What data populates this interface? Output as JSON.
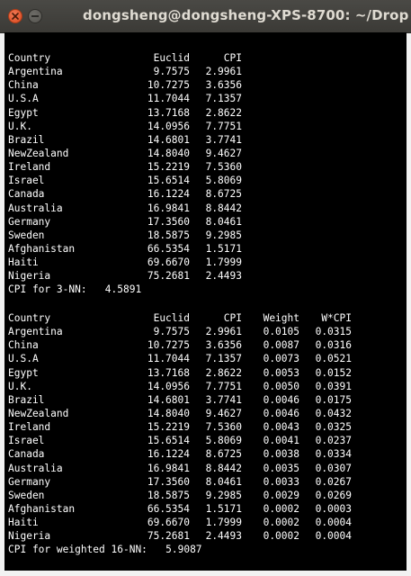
{
  "window": {
    "title": "dongsheng@dongsheng-XPS-8700: ~/Drop",
    "buttons": {
      "close": "close-icon",
      "minimize": "minimize-icon"
    },
    "colors": {
      "titlebar": "#3c3b37",
      "close": "#e0522a",
      "terminal_bg": "#000000",
      "text": "#ffffff"
    }
  },
  "table1": {
    "headers": [
      "Country",
      "Euclid",
      "CPI"
    ],
    "rows": [
      [
        "Argentina",
        "9.7575",
        "2.9961"
      ],
      [
        "China",
        "10.7275",
        "3.6356"
      ],
      [
        "U.S.A",
        "11.7044",
        "7.1357"
      ],
      [
        "Egypt",
        "13.7168",
        "2.8622"
      ],
      [
        "U.K.",
        "14.0956",
        "7.7751"
      ],
      [
        "Brazil",
        "14.6801",
        "3.7741"
      ],
      [
        "NewZealand",
        "14.8040",
        "9.4627"
      ],
      [
        "Ireland",
        "15.2219",
        "7.5360"
      ],
      [
        "Israel",
        "15.6514",
        "5.8069"
      ],
      [
        "Canada",
        "16.1224",
        "8.6725"
      ],
      [
        "Australia",
        "16.9841",
        "8.8442"
      ],
      [
        "Germany",
        "17.3560",
        "8.0461"
      ],
      [
        "Sweden",
        "18.5875",
        "9.2985"
      ],
      [
        "Afghanistan",
        "66.5354",
        "1.5171"
      ],
      [
        "Haiti",
        "69.6670",
        "1.7999"
      ],
      [
        "Nigeria",
        "75.2681",
        "2.4493"
      ]
    ],
    "result": "CPI for 3-NN:   4.5891"
  },
  "table2": {
    "headers": [
      "Country",
      "Euclid",
      "CPI",
      "Weight",
      "W*CPI"
    ],
    "rows": [
      [
        "Argentina",
        "9.7575",
        "2.9961",
        "0.0105",
        "0.0315"
      ],
      [
        "China",
        "10.7275",
        "3.6356",
        "0.0087",
        "0.0316"
      ],
      [
        "U.S.A",
        "11.7044",
        "7.1357",
        "0.0073",
        "0.0521"
      ],
      [
        "Egypt",
        "13.7168",
        "2.8622",
        "0.0053",
        "0.0152"
      ],
      [
        "U.K.",
        "14.0956",
        "7.7751",
        "0.0050",
        "0.0391"
      ],
      [
        "Brazil",
        "14.6801",
        "3.7741",
        "0.0046",
        "0.0175"
      ],
      [
        "NewZealand",
        "14.8040",
        "9.4627",
        "0.0046",
        "0.0432"
      ],
      [
        "Ireland",
        "15.2219",
        "7.5360",
        "0.0043",
        "0.0325"
      ],
      [
        "Israel",
        "15.6514",
        "5.8069",
        "0.0041",
        "0.0237"
      ],
      [
        "Canada",
        "16.1224",
        "8.6725",
        "0.0038",
        "0.0334"
      ],
      [
        "Australia",
        "16.9841",
        "8.8442",
        "0.0035",
        "0.0307"
      ],
      [
        "Germany",
        "17.3560",
        "8.0461",
        "0.0033",
        "0.0267"
      ],
      [
        "Sweden",
        "18.5875",
        "9.2985",
        "0.0029",
        "0.0269"
      ],
      [
        "Afghanistan",
        "66.5354",
        "1.5171",
        "0.0002",
        "0.0003"
      ],
      [
        "Haiti",
        "69.6670",
        "1.7999",
        "0.0002",
        "0.0004"
      ],
      [
        "Nigeria",
        "75.2681",
        "2.4493",
        "0.0002",
        "0.0004"
      ]
    ],
    "result": "CPI for weighted 16-NN:   5.9087"
  }
}
